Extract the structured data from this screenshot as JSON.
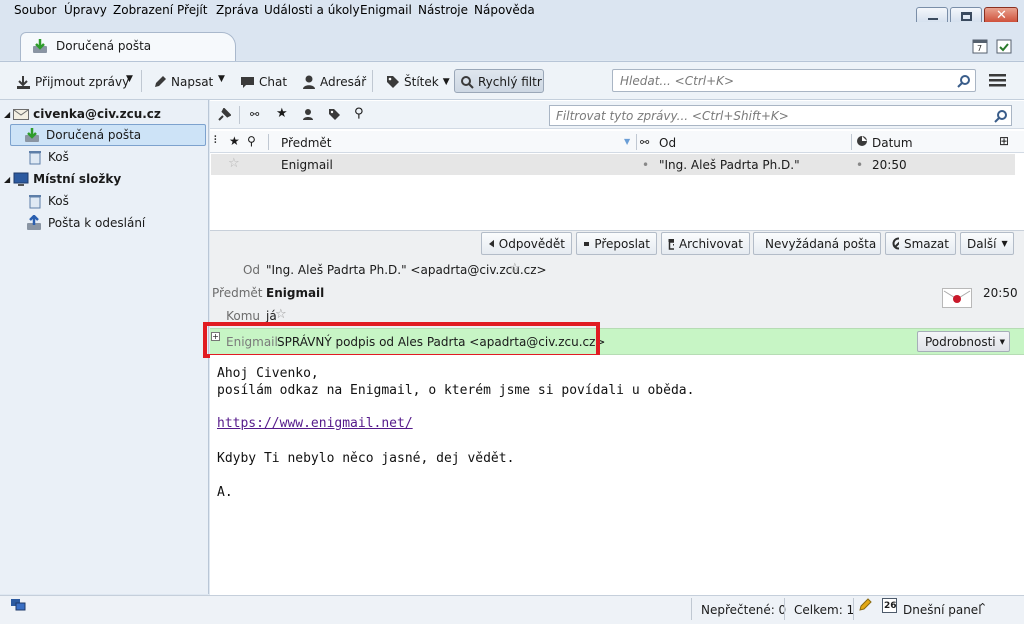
{
  "menu": [
    "Soubor",
    "Úpravy",
    "Zobrazení",
    "Přejít",
    "Zpráva",
    "Události a úkoly",
    "Enigmail",
    "Nástroje",
    "Nápověda"
  ],
  "tab": {
    "label": "Doručená pošta"
  },
  "toolbar": {
    "get_mail": "Přijmout zprávy",
    "write": "Napsat",
    "chat": "Chat",
    "address_book": "Adresář",
    "tag": "Štítek",
    "quick_filter": "Rychlý filtr",
    "search_placeholder": "Hledat... <Ctrl+K>"
  },
  "folders": {
    "account": "civenka@civ.zcu.cz",
    "inbox": "Doručená pošta",
    "trash": "Koš",
    "local_folders": "Místní složky",
    "local_trash": "Koš",
    "outbox": "Pošta k odeslání"
  },
  "filter": {
    "placeholder": "Filtrovat tyto zprávy... <Ctrl+Shift+K>"
  },
  "columns": {
    "subject": "Předmět",
    "from": "Od",
    "date": "Datum"
  },
  "messages": [
    {
      "subject": "Enigmail",
      "from": "\"Ing. Aleš Padrta Ph.D.\"",
      "date": "20:50"
    }
  ],
  "header_buttons": {
    "reply": "Odpovědět",
    "forward": "Přeposlat",
    "archive": "Archivovat",
    "junk": "Nevyžádaná pošta",
    "delete": "Smazat",
    "more": "Další"
  },
  "header": {
    "from_label": "Od",
    "from_value": "\"Ing. Aleš Padrta Ph.D.\" <apadrta@civ.zcu.cz>",
    "subject_label": "Předmět",
    "subject_value": "Enigmail",
    "to_label": "Komu",
    "to_value": "já",
    "time": "20:50"
  },
  "enigmail": {
    "label": "Enigmail",
    "status": "SPRÁVNÝ podpis od Ales Padrta <apadrta@civ.zcu.cz>",
    "details_button": "Podrobnosti"
  },
  "body": {
    "line1": "Ahoj Civenko,",
    "line2": "posílám odkaz na Enigmail, o kterém jsme si povídali u oběda.",
    "link": "https://www.enigmail.net/",
    "line3": "Kdyby Ti nebylo něco jasné, dej vědět.",
    "line4": "A."
  },
  "status": {
    "unread": "Nepřečtené: 0",
    "total": "Celkem: 1",
    "today_pane": "Dnešní panel",
    "calendar_day": "26"
  },
  "colors": {
    "signature_ok": "#c7f5c5",
    "highlight_box": "#e11b22",
    "selection": "#cde3f7"
  }
}
